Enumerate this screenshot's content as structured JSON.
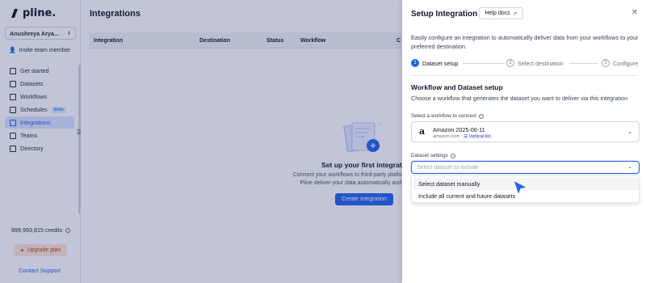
{
  "sidebar": {
    "brand": "pline.",
    "user": "Anushreya Arya...",
    "invite_label": "Invite team member",
    "items": [
      {
        "label": "Get started",
        "icon": "rocket-icon",
        "active": false
      },
      {
        "label": "Datasets",
        "icon": "dataset-icon",
        "active": false
      },
      {
        "label": "Workflows",
        "icon": "workflow-icon",
        "active": false
      },
      {
        "label": "Schedules",
        "icon": "calendar-icon",
        "active": false,
        "badge": "Beta"
      },
      {
        "label": "Integrations",
        "icon": "link-icon",
        "active": true
      },
      {
        "label": "Teams",
        "icon": "users-icon",
        "active": false
      },
      {
        "label": "Directory",
        "icon": "folder-icon",
        "active": false
      }
    ],
    "credits": "999,993,815 credits",
    "upgrade_label": "Upgrade plan",
    "contact_label": "Contact Support"
  },
  "main": {
    "title": "Integrations",
    "columns": [
      "Integration",
      "Destination",
      "Status",
      "Workflow",
      "C"
    ],
    "empty_title": "Set up your first integration",
    "empty_desc": "Connect your workflows to third-party platforms. Pline deliver your data automatically and c",
    "create_label": "Create integration"
  },
  "drawer": {
    "title": "Setup Integration",
    "help_label": "Help docs",
    "intro": "Easily configure an integration to automatically deliver data from your workflows to your preferred destination.",
    "steps": [
      {
        "num": "1",
        "label": "Dataset setup",
        "active": true
      },
      {
        "num": "2",
        "label": "Select destination",
        "active": false
      },
      {
        "num": "3",
        "label": "Configure",
        "active": false
      }
    ],
    "section_title": "Workflow and Dataset setup",
    "section_desc": "Choose a workflow that generates the dataset you want to deliver via this integration",
    "workflow_label": "Select a workflow to connect",
    "workflow": {
      "logo": "a",
      "name": "Amazon 2025-06-11",
      "domain": "amazon.com",
      "badge": "Vertical list"
    },
    "dataset_label": "Dataset settings",
    "dataset_placeholder": "Select dataset to include",
    "dataset_options": [
      "Select dataset manually",
      "Include all current and future datasets"
    ]
  },
  "colors": {
    "accent": "#2563eb",
    "overlay": "#232d6e"
  }
}
